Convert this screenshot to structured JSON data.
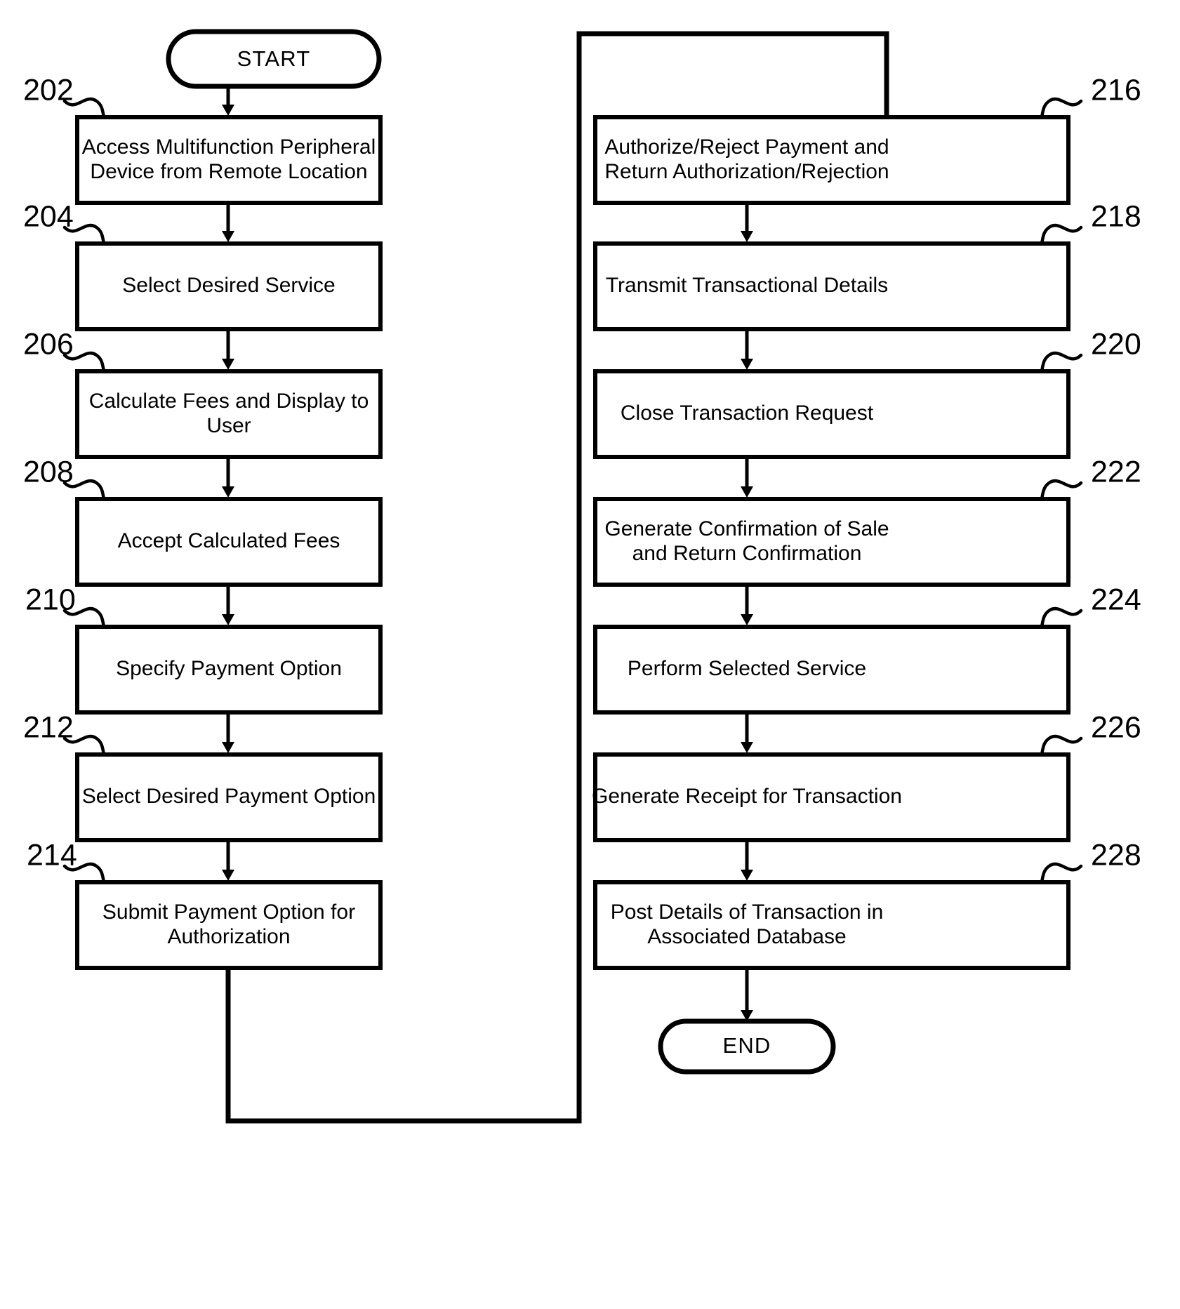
{
  "figure": {
    "type": "process-flowchart",
    "orientation": "two-column",
    "background_color": "#ffffff",
    "line_color": "#000000"
  },
  "terminators": {
    "start": {
      "label": "START",
      "ref": ""
    },
    "end": {
      "label": "END",
      "ref": ""
    }
  },
  "left_column": {
    "steps": [
      {
        "ref": "202",
        "label_lines": [
          "Access Multifunction Peripheral",
          "Device from Remote Location"
        ],
        "label": "Access Multifunction Peripheral Device from Remote Location"
      },
      {
        "ref": "204",
        "label_lines": [
          "Select Desired Service"
        ],
        "label": "Select Desired Service"
      },
      {
        "ref": "206",
        "label_lines": [
          "Calculate Fees and Display to",
          "User"
        ],
        "label": "Calculate Fees and Display to User"
      },
      {
        "ref": "208",
        "label_lines": [
          "Accept Calculated Fees"
        ],
        "label": "Accept Calculated Fees"
      },
      {
        "ref": "210",
        "label_lines": [
          "Specify Payment Option"
        ],
        "label": "Specify Payment Option"
      },
      {
        "ref": "212",
        "label_lines": [
          "Select Desired Payment Option"
        ],
        "label": "Select Desired Payment Option"
      },
      {
        "ref": "214",
        "label_lines": [
          "Submit Payment Option for",
          "Authorization"
        ],
        "label": "Submit Payment Option for Authorization"
      }
    ]
  },
  "right_column": {
    "steps": [
      {
        "ref": "216",
        "label_lines": [
          "Authorize/Reject Payment and",
          "Return Authorization/Rejection"
        ],
        "label": "Authorize/Reject Payment and Return Authorization/Rejection"
      },
      {
        "ref": "218",
        "label_lines": [
          "Transmit Transactional Details"
        ],
        "label": "Transmit Transactional Details"
      },
      {
        "ref": "220",
        "label_lines": [
          "Close Transaction Request"
        ],
        "label": "Close Transaction Request"
      },
      {
        "ref": "222",
        "label_lines": [
          "Generate Confirmation of Sale",
          "and Return Confirmation"
        ],
        "label": "Generate Confirmation of Sale and Return Confirmation"
      },
      {
        "ref": "224",
        "label_lines": [
          "Perform Selected Service"
        ],
        "label": "Perform Selected Service"
      },
      {
        "ref": "226",
        "label_lines": [
          "Generate Receipt for Transaction"
        ],
        "label": "Generate Receipt for Transaction"
      },
      {
        "ref": "228",
        "label_lines": [
          "Post Details of Transaction in",
          "Associated Database"
        ],
        "label": "Post Details of Transaction in Associated Database"
      }
    ]
  },
  "connectors": {
    "feedback_loop_description": "From bottom of step 214, down then right then up around the top and down into step 216"
  }
}
